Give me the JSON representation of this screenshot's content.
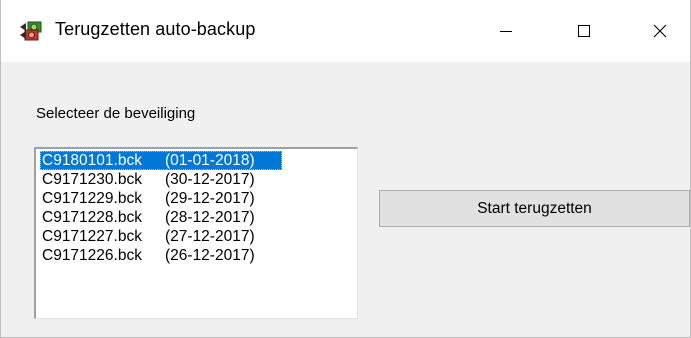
{
  "window": {
    "title": "Terugzetten auto-backup",
    "icon": "app-gear-arrows-icon"
  },
  "caption_buttons": [
    "minimize",
    "maximize",
    "close"
  ],
  "label": "Selecteer de beveiliging",
  "backups": [
    {
      "file": "C9180101.bck",
      "date": "(01-01-2018)",
      "selected": true
    },
    {
      "file": "C9171230.bck",
      "date": "(30-12-2017)",
      "selected": false
    },
    {
      "file": "C9171229.bck",
      "date": "(29-12-2017)",
      "selected": false
    },
    {
      "file": "C9171228.bck",
      "date": "(28-12-2017)",
      "selected": false
    },
    {
      "file": "C9171227.bck",
      "date": "(27-12-2017)",
      "selected": false
    },
    {
      "file": "C9171226.bck",
      "date": "(26-12-2017)",
      "selected": false
    }
  ],
  "start_button_label": "Start terugzetten",
  "colors": {
    "selection": "#0078d7",
    "window_bg": "#f0f0f0",
    "button_bg": "#e1e1e1"
  }
}
